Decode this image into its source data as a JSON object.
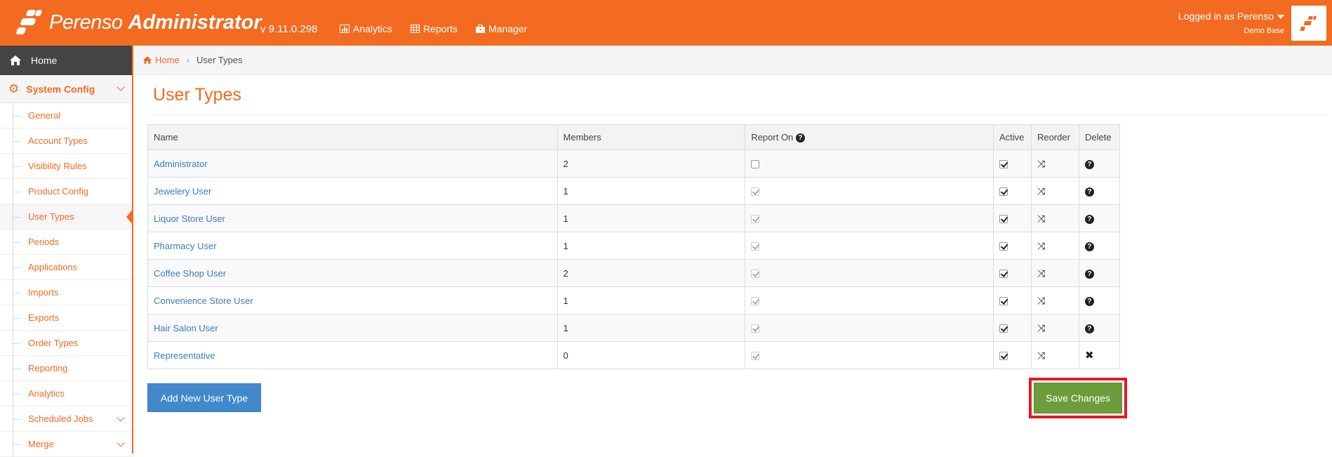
{
  "app": {
    "brand": "Perenso",
    "title": "Administrator",
    "version": "v 9.11.0.298",
    "accent_color": "#f26b21"
  },
  "topnav": [
    {
      "label": "Analytics",
      "icon": "chart-icon"
    },
    {
      "label": "Reports",
      "icon": "table-icon"
    },
    {
      "label": "Manager",
      "icon": "briefcase-icon"
    }
  ],
  "user": {
    "login_text": "Logged in as Perenso",
    "database": "Demo Base"
  },
  "sidebar": {
    "home_label": "Home",
    "section_label": "System Config",
    "items": [
      {
        "label": "General"
      },
      {
        "label": "Account Types"
      },
      {
        "label": "Visibility Rules"
      },
      {
        "label": "Product Config"
      },
      {
        "label": "User Types",
        "active": true
      },
      {
        "label": "Periods"
      },
      {
        "label": "Applications"
      },
      {
        "label": "Imports"
      },
      {
        "label": "Exports"
      },
      {
        "label": "Order Types"
      },
      {
        "label": "Reporting"
      },
      {
        "label": "Analytics"
      },
      {
        "label": "Scheduled Jobs",
        "expandable": true
      },
      {
        "label": "Merge",
        "expandable": true
      }
    ]
  },
  "breadcrumb": {
    "home": "Home",
    "current": "User Types"
  },
  "page": {
    "title": "User Types"
  },
  "table": {
    "columns": [
      "Name",
      "Members",
      "Report On",
      "Active",
      "Reorder",
      "Delete"
    ],
    "rows": [
      {
        "name": "Administrator",
        "members": "2",
        "report_on": false,
        "report_on_enabled": true,
        "active": true,
        "delete": "help"
      },
      {
        "name": "Jewelery User",
        "members": "1",
        "report_on": true,
        "report_on_enabled": false,
        "active": true,
        "delete": "help"
      },
      {
        "name": "Liquor Store User",
        "members": "1",
        "report_on": true,
        "report_on_enabled": false,
        "active": true,
        "delete": "help"
      },
      {
        "name": "Pharmacy User",
        "members": "1",
        "report_on": true,
        "report_on_enabled": false,
        "active": true,
        "delete": "help"
      },
      {
        "name": "Coffee Shop User",
        "members": "2",
        "report_on": true,
        "report_on_enabled": false,
        "active": true,
        "delete": "help"
      },
      {
        "name": "Convenience Store User",
        "members": "1",
        "report_on": true,
        "report_on_enabled": false,
        "active": true,
        "delete": "help"
      },
      {
        "name": "Hair Salon User",
        "members": "1",
        "report_on": true,
        "report_on_enabled": false,
        "active": true,
        "delete": "help"
      },
      {
        "name": "Representative",
        "members": "0",
        "report_on": true,
        "report_on_enabled": false,
        "active": true,
        "delete": "remove"
      }
    ]
  },
  "actions": {
    "add_label": "Add New User Type",
    "save_label": "Save Changes"
  }
}
